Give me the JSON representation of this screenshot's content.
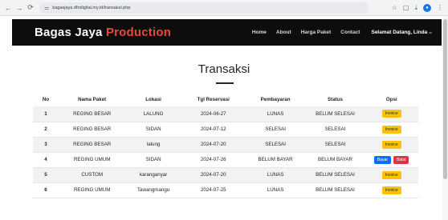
{
  "browser": {
    "back_icon": "←",
    "forward_icon": "→",
    "reload_icon": "⟳",
    "url": "bagasjaya.dfndigital.my.id/transaksi.php",
    "icons": [
      "star-icon",
      "tab-icon",
      "download-icon",
      "profile-icon",
      "menu-icon"
    ]
  },
  "navbar": {
    "brand_main": "Bagas Jaya ",
    "brand_accent": "Production",
    "links": [
      "Home",
      "About",
      "Harga Paket",
      "Contact"
    ],
    "user_greeting": "Selamat Datang, Linda",
    "accent_color": "#e84a3a",
    "bg_color": "#0d0d0d"
  },
  "page": {
    "title": "Transaksi"
  },
  "table": {
    "headers": [
      "No",
      "Nama Paket",
      "Lokasi",
      "Tgl Reservasi",
      "Pembayaran",
      "Status",
      "Opsi"
    ],
    "rows": [
      {
        "no": "1",
        "paket": "REGING BESAR",
        "lokasi": "LALUNG",
        "tgl": "2024-06-27",
        "pembayaran": "LUNAS",
        "status": "BELUM SELESAI",
        "opsi": [
          "Invoice"
        ]
      },
      {
        "no": "2",
        "paket": "REGING BESAR",
        "lokasi": "SIDAN",
        "tgl": "2024-07-12",
        "pembayaran": "SELESAI",
        "status": "SELESAI",
        "opsi": [
          "Invoice"
        ]
      },
      {
        "no": "3",
        "paket": "REGING BESAR",
        "lokasi": "lalung",
        "tgl": "2024-07-20",
        "pembayaran": "SELESAI",
        "status": "SELESAI",
        "opsi": [
          "Invoice"
        ]
      },
      {
        "no": "4",
        "paket": "REGING UMUM",
        "lokasi": "SIDAN",
        "tgl": "2024-07-26",
        "pembayaran": "BELUM BAYAR",
        "status": "BELUM BAYAR",
        "opsi": [
          "Bayar",
          "Batal"
        ]
      },
      {
        "no": "5",
        "paket": "CUSTOM",
        "lokasi": "karanganyar",
        "tgl": "2024-07-20",
        "pembayaran": "LUNAS",
        "status": "BELUM SELESAI",
        "opsi": [
          "Invoice"
        ]
      },
      {
        "no": "6",
        "paket": "REGING UMUM",
        "lokasi": "Tawangmangu",
        "tgl": "2024-07-25",
        "pembayaran": "LUNAS",
        "status": "BELUM SELESAI",
        "opsi": [
          "Invoice"
        ]
      }
    ]
  },
  "colors": {
    "invoice": "#ffc107",
    "bayar": "#0d6efd",
    "batal": "#dc3545"
  }
}
